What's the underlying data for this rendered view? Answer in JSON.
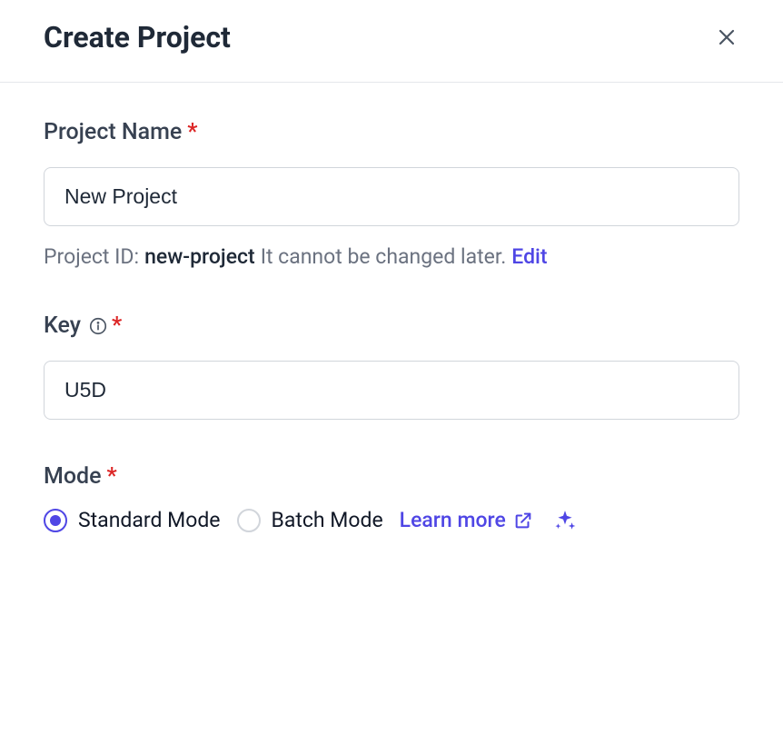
{
  "header": {
    "title": "Create Project"
  },
  "project_name": {
    "label": "Project Name",
    "value": "New Project"
  },
  "project_id": {
    "prefix": "Project ID:",
    "value": "new-project",
    "note": "It cannot be changed later.",
    "edit_label": "Edit"
  },
  "key": {
    "label": "Key",
    "value": "U5D"
  },
  "mode": {
    "label": "Mode",
    "options": {
      "standard": "Standard Mode",
      "batch": "Batch Mode"
    },
    "selected": "standard",
    "learn_more": "Learn more"
  },
  "required_marker": "*"
}
